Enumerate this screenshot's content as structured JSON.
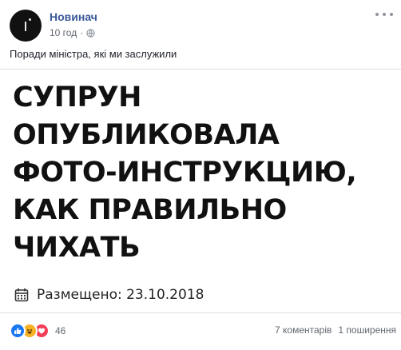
{
  "post": {
    "page_name": "Новинач",
    "time": "10 год",
    "separator": "·",
    "caption": "Поради міністра, які ми заслужили"
  },
  "shared_image": {
    "headline_lines": [
      "СУПРУН",
      "ОПУБЛИКОВАЛА",
      "ФОТО-ИНСТРУКЦИЮ,",
      "КАК ПРАВИЛЬНО",
      "ЧИХАТЬ"
    ],
    "posted_text": "Размещено: 23.10.2018"
  },
  "footer": {
    "reactions": [
      "like-icon",
      "haha-icon",
      "love-icon"
    ],
    "reaction_count": "46",
    "comments": "7 коментарів",
    "shares": "1 поширення"
  },
  "colors": {
    "page_name": "#385898",
    "like": "#1877f2",
    "haha": "#f7b125",
    "love": "#f33e58",
    "meta": "#616770"
  }
}
